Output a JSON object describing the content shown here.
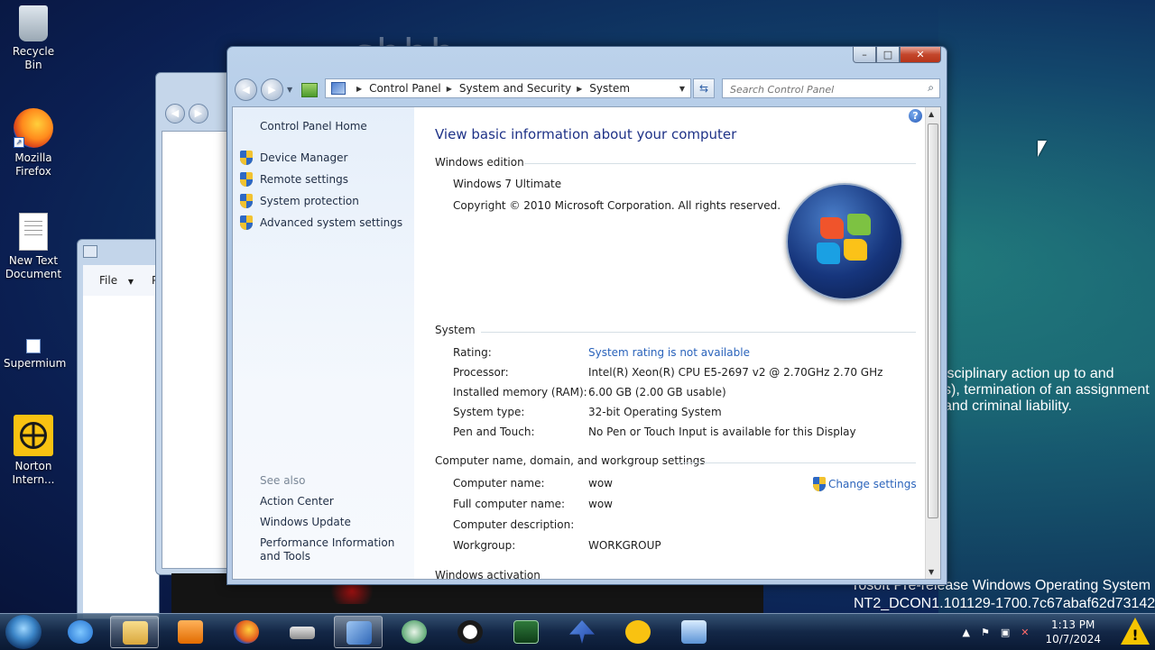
{
  "desktop": {
    "icons": [
      {
        "label": "Recycle Bin"
      },
      {
        "label": "Mozilla Firefox"
      },
      {
        "label": "New Text Document"
      },
      {
        "label": "Supermium"
      },
      {
        "label": "Norton Intern..."
      }
    ],
    "overlay_text": [
      "isciplinary action up to and",
      "s), termination of an assignment",
      "and criminal liability."
    ],
    "build_text": [
      "rosoft Pre-release Windows Operating System",
      "NT2_DCON1.101129-1700.7c67abaf62d73142"
    ],
    "background_word": "shhh"
  },
  "bg_window": {
    "file_menu": "File",
    "file_menu_trail": "P"
  },
  "window": {
    "breadcrumb": [
      "Control Panel",
      "System and Security",
      "System"
    ],
    "search_placeholder": "Search Control Panel",
    "caption": {
      "minimize": "–",
      "maximize": "□",
      "close": "✕"
    },
    "left_pane": {
      "home": "Control Panel Home",
      "tasks": [
        "Device Manager",
        "Remote settings",
        "System protection",
        "Advanced system settings"
      ],
      "see_also_header": "See also",
      "see_also": [
        "Action Center",
        "Windows Update",
        "Performance Information and Tools"
      ]
    },
    "main": {
      "title": "View basic information about your computer",
      "edition_header": "Windows edition",
      "edition": "Windows 7 Ultimate",
      "copyright": "Copyright © 2010 Microsoft Corporation.  All rights reserved.",
      "system_header": "System",
      "system_rows": [
        {
          "label": "Rating:",
          "value": "System rating is not available",
          "link": true
        },
        {
          "label": "Processor:",
          "value": "Intel(R) Xeon(R) CPU E5-2697 v2 @ 2.70GHz   2.70 GHz"
        },
        {
          "label": "Installed memory (RAM):",
          "value": "6.00 GB (2.00 GB usable)"
        },
        {
          "label": "System type:",
          "value": "32-bit Operating System"
        },
        {
          "label": "Pen and Touch:",
          "value": "No Pen or Touch Input is available for this Display"
        }
      ],
      "computer_header": "Computer name, domain, and workgroup settings",
      "change_settings": "Change settings",
      "computer_rows": [
        {
          "label": "Computer name:",
          "value": "wow"
        },
        {
          "label": "Full computer name:",
          "value": "wow"
        },
        {
          "label": "Computer description:",
          "value": ""
        },
        {
          "label": "Workgroup:",
          "value": "WORKGROUP"
        }
      ],
      "activation_header": "Windows activation"
    }
  },
  "taskbar": {
    "apps": [
      "internet-explorer",
      "file-explorer",
      "media-player",
      "firefox",
      "drive",
      "control-panel",
      "network-globe",
      "panda",
      "task-manager",
      "bird-app",
      "norton",
      "remote-desktop"
    ],
    "active_app": "control-panel",
    "time": "1:13 PM",
    "date": "10/7/2024"
  },
  "colors": {
    "accent_link": "#2a63bb",
    "title_blue": "#1e3287",
    "warning_yellow": "#f5c400"
  }
}
